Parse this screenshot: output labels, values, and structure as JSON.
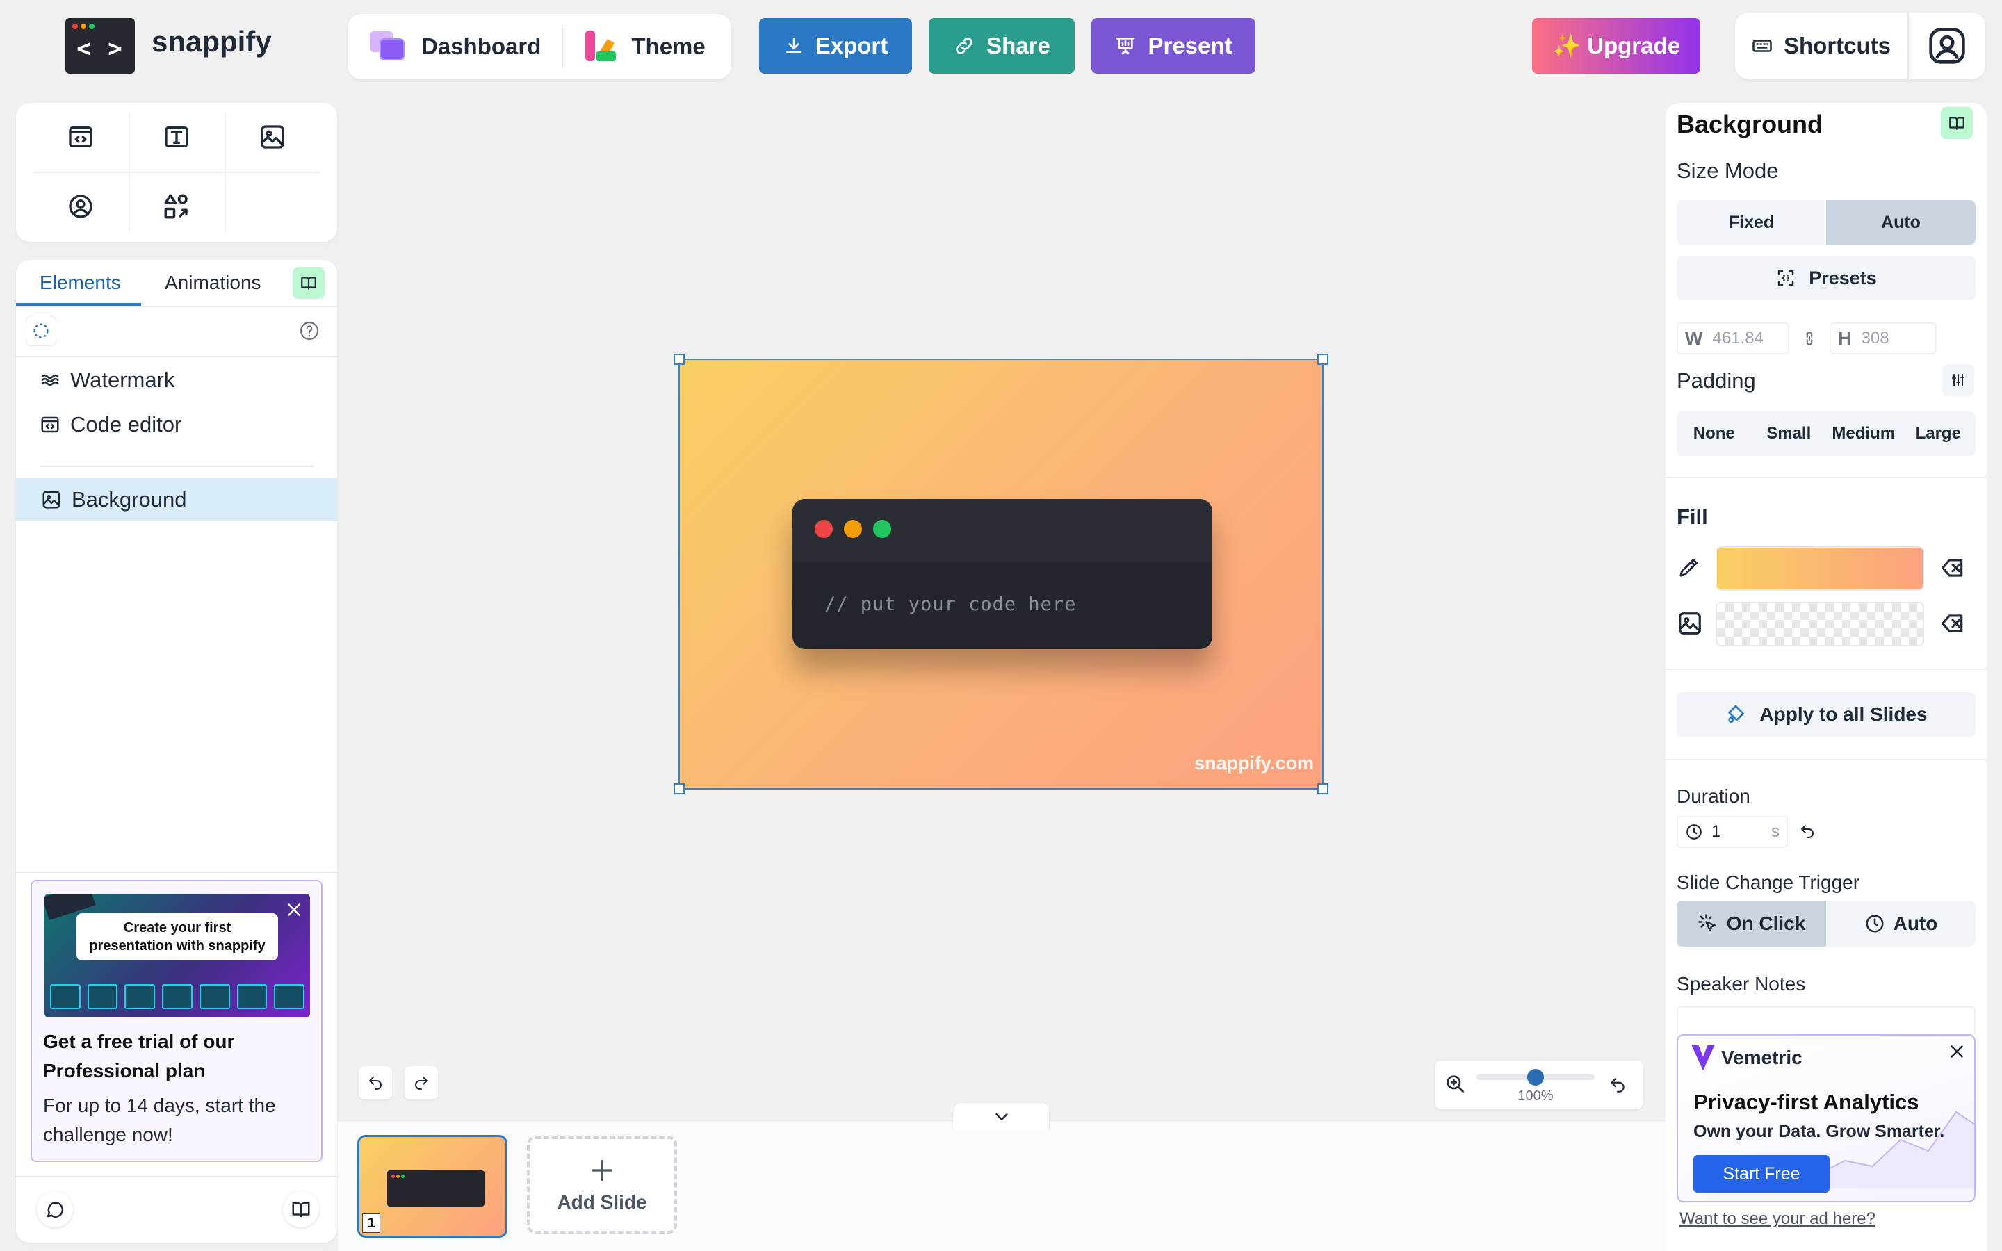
{
  "app": {
    "name": "snappify",
    "logo_glyph": "< >"
  },
  "topbar": {
    "dashboard": "Dashboard",
    "theme": "Theme",
    "export": "Export",
    "share": "Share",
    "present": "Present",
    "upgrade": "✨ Upgrade",
    "shortcuts": "Shortcuts"
  },
  "colors": {
    "export": "#2b78c5",
    "share": "#2a9d8f",
    "present": "#7c57d4",
    "upgrade_from": "#fb7185",
    "upgrade_to": "#9333ea",
    "selection": "#3b82c4"
  },
  "tools": [
    "code-window-icon",
    "text-icon",
    "image-icon",
    "avatar-icon",
    "shapes-icon"
  ],
  "sidebar": {
    "tabs": [
      "Elements",
      "Animations"
    ],
    "active_tab": "Elements",
    "layers": [
      {
        "label": "Watermark",
        "icon": "watermark-icon"
      },
      {
        "label": "Code editor",
        "icon": "code-window-icon"
      }
    ],
    "selected_layer": {
      "label": "Background",
      "icon": "image-icon"
    }
  },
  "promo": {
    "banner": "Create your first presentation with snappify",
    "title": "Get a free trial of our Professional plan",
    "body": "For up to 14 days, start the challenge now!"
  },
  "canvas": {
    "code_placeholder": "// put your code here",
    "watermark": "snappify.com"
  },
  "zoom": {
    "label": "100%",
    "level": 0.5
  },
  "slides": {
    "items": [
      {
        "number": "1"
      }
    ],
    "add_label": "Add Slide"
  },
  "inspector": {
    "title": "Background",
    "size_mode": {
      "label": "Size Mode",
      "options": [
        "Fixed",
        "Auto"
      ],
      "selected": "Auto"
    },
    "presets": "Presets",
    "width": {
      "label": "W",
      "value": "461.84"
    },
    "height": {
      "label": "H",
      "value": "308"
    },
    "padding": {
      "label": "Padding",
      "options": [
        "None",
        "Small",
        "Medium",
        "Large"
      ]
    },
    "fill": {
      "label": "Fill"
    },
    "apply_all": "Apply to all Slides",
    "duration": {
      "label": "Duration",
      "value": "1",
      "unit": "s"
    },
    "trigger": {
      "label": "Slide Change Trigger",
      "options": [
        "On Click",
        "Auto"
      ],
      "selected": "On Click"
    },
    "speaker_notes": {
      "label": "Speaker Notes"
    }
  },
  "ad": {
    "brand": "Vemetric",
    "headline": "Privacy-first Analytics",
    "tagline": "Own your Data. Grow Smarter.",
    "cta": "Start Free",
    "footer_link": "Want to see your ad here?"
  }
}
